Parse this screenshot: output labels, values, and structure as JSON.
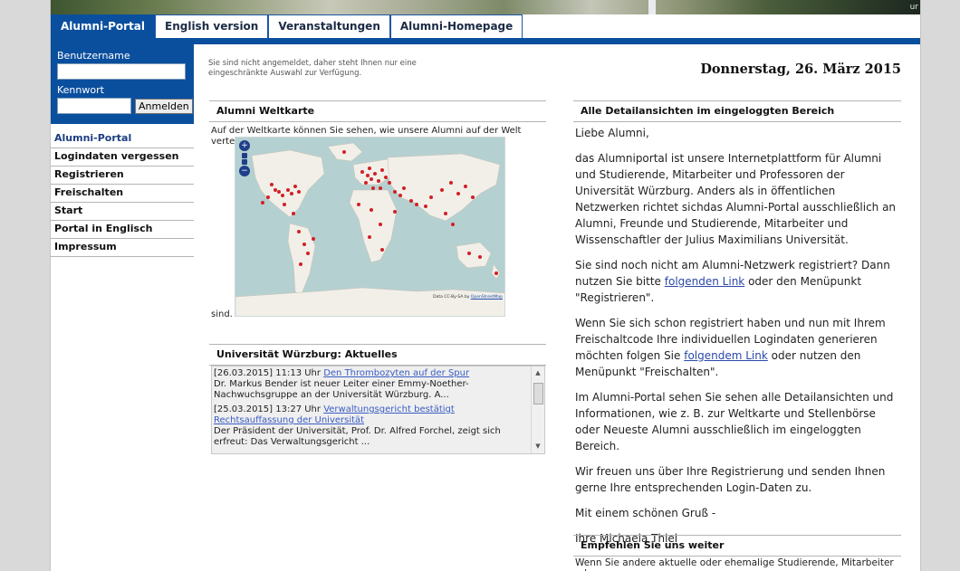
{
  "banner": {
    "tagline": "ur"
  },
  "tabs": [
    {
      "label": "Alumni-Portal",
      "active": true
    },
    {
      "label": "English version",
      "active": false
    },
    {
      "label": "Veranstaltungen",
      "active": false
    },
    {
      "label": "Alumni-Homepage",
      "active": false
    }
  ],
  "login": {
    "username_label": "Benutzername",
    "username_value": "",
    "password_label": "Kennwort",
    "password_value": "",
    "submit_label": "Anmelden"
  },
  "sidenav": [
    {
      "label": "Alumni-Portal",
      "active": true
    },
    {
      "label": "Logindaten vergessen"
    },
    {
      "label": "Registrieren"
    },
    {
      "label": "Freischalten"
    },
    {
      "label": "Start"
    },
    {
      "label": "Portal in Englisch"
    },
    {
      "label": "Impressum"
    }
  ],
  "notice": "Sie sind nicht angemeldet, daher steht Ihnen nur eine eingeschränkte Auswahl zur Verfügung.",
  "date": "Donnerstag, 26. März 2015",
  "map_box": {
    "title": "Alumni Weltkarte",
    "description": "Auf der Weltkarte können Sie sehen, wie unsere Alumni auf der Welt verteilt",
    "description_end": "sind.",
    "credit": "Data CC-By-SA by",
    "credit_link": "OpenStreetMap",
    "zoom_in": "+",
    "zoom_out": "−"
  },
  "news_box": {
    "title": "Universität Würzburg: Aktuelles",
    "items": [
      {
        "meta": "[26.03.2015] 11:13 Uhr",
        "link": "Den Thrombozyten auf der Spur",
        "text": "Dr. Markus Bender ist neuer Leiter einer Emmy-Noether-Nachwuchsgruppe an der Universität Würzburg. A..."
      },
      {
        "meta": "[25.03.2015] 13:27 Uhr",
        "link": "Verwaltungsgericht bestätigt Rechtsauffassung der Universität",
        "text": "Der Präsident der Universität, Prof. Dr. Alfred Forchel, zeigt sich erfreut: Das Verwaltungsgericht ..."
      }
    ]
  },
  "details_box": {
    "title": "Alle Detailansichten im eingeloggten Bereich",
    "greeting": "Liebe Alumni,",
    "p1": "das Alumniportal ist unsere Internetplattform für Alumni und Studierende, Mitarbeiter und Professoren der Universität Würzburg. Anders als in öffentlichen Netzwerken richtet sichdas Alumni-Portal ausschließlich an Alumni, Freunde und Studierende, Mitarbeiter und Wissenschaftler der Julius Maximilians Universität.",
    "p2_before": "Sie sind noch nicht am Alumni-Netzwerk registriert? Dann nutzen Sie bitte",
    "p2_link": "folgenden Link",
    "p2_after": "oder den Menüpunkt \"Registrieren\".",
    "p3_before": "Wenn Sie sich schon registriert haben und nun mit Ihrem Freischaltcode Ihre individuellen Logindaten generieren möchten folgen Sie",
    "p3_link": "folgendem Link",
    "p3_after": "oder nutzen den Menüpunkt \"Freischalten\".",
    "p4": "Im Alumni-Portal sehen Sie sehen alle Detailansichten und Informationen, wie z. B. zur Weltkarte und Stellenbörse oder Neueste Alumni ausschließlich im eingeloggten Bereich.",
    "p5": "Wir freuen uns über Ihre Registrierung und senden Ihnen gerne Ihre entsprechenden Login-Daten zu.",
    "p6": "Mit einem schönen Gruß -",
    "p7": "Ihre Michaela Thiel"
  },
  "recommend_box": {
    "title": "Empfehlen Sie uns weiter",
    "text": "Wenn Sie andere aktuelle oder ehemalige Studierende, Mitarbeiter oder"
  },
  "colors": {
    "primary_blue": "#0a4f9e",
    "link": "#2a48a8",
    "map_water": "#b5d0d0",
    "map_land": "#f2efe9",
    "marker": "#d21f26"
  }
}
